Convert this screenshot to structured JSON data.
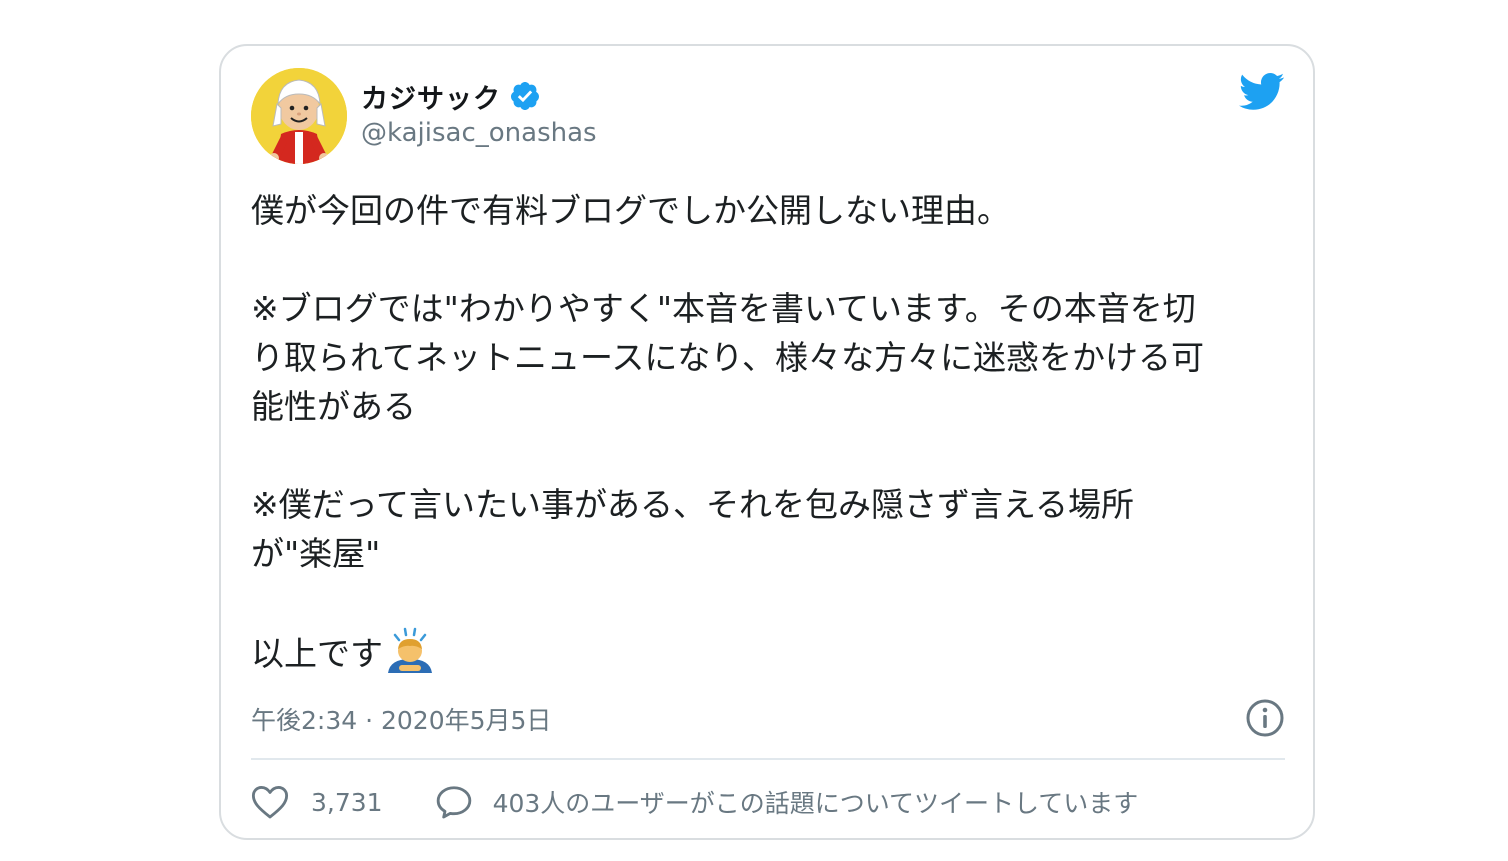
{
  "tweet": {
    "author": {
      "display_name": "カジサック",
      "handle": "@kajisac_onashas",
      "verified_icon": "verified-badge-icon",
      "avatar": "avatar"
    },
    "brand_icon": "twitter-bird-icon",
    "text": {
      "line1": "僕が今回の件で有料ブログでしか公開しない理由。",
      "para2_line1": "※ブログでは\"わかりやすく\"本音を書いています。その本音を切",
      "para2_line2": "り取られてネットニュースになり、様々な方々に迷惑をかける可",
      "para2_line3": "能性がある",
      "para3_line1": "※僕だって言いたい事がある、それを包み隠さず言える場所",
      "para3_line2": "が\"楽屋\"",
      "closing": "以上です",
      "closing_emoji": "bowing-man-emoji"
    },
    "timestamp": "午後2:34 · 2020年5月5日",
    "info_icon": "info-icon",
    "likes": "3,731",
    "conversation_text": "403人のユーザーがこの話題についてツイートしています"
  },
  "colors": {
    "brand_blue": "#1da1f2",
    "text_primary": "#1c2022",
    "text_secondary": "#697882",
    "border": "#d9dde0"
  }
}
